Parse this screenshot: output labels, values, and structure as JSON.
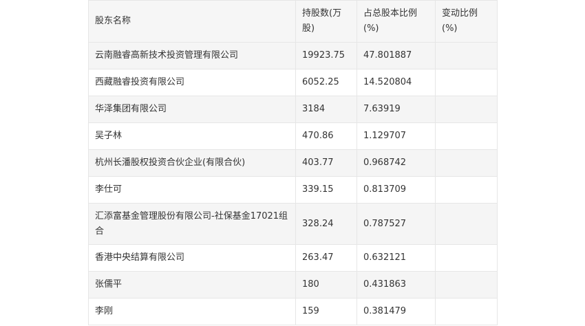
{
  "table": {
    "headers": {
      "name": "股东名称",
      "shares": "持股数(万股)",
      "ratio": "占总股本比例(%)",
      "change": "变动比例(%)"
    },
    "rows": [
      {
        "name": "云南融睿高新技术投资管理有限公司",
        "shares": "19923.75",
        "ratio": "47.801887",
        "change": ""
      },
      {
        "name": "西藏融睿投资有限公司",
        "shares": "6052.25",
        "ratio": "14.520804",
        "change": ""
      },
      {
        "name": "华泽集团有限公司",
        "shares": "3184",
        "ratio": "7.63919",
        "change": ""
      },
      {
        "name": "吴子林",
        "shares": "470.86",
        "ratio": "1.129707",
        "change": ""
      },
      {
        "name": "杭州长潘股权投资合伙企业(有限合伙)",
        "shares": "403.77",
        "ratio": "0.968742",
        "change": ""
      },
      {
        "name": "李仕可",
        "shares": "339.15",
        "ratio": "0.813709",
        "change": ""
      },
      {
        "name": "汇添富基金管理股份有限公司-社保基金17021组合",
        "shares": "328.24",
        "ratio": "0.787527",
        "change": ""
      },
      {
        "name": "香港中央结算有限公司",
        "shares": "263.47",
        "ratio": "0.632121",
        "change": ""
      },
      {
        "name": "张儒平",
        "shares": "180",
        "ratio": "0.431863",
        "change": ""
      },
      {
        "name": "李刚",
        "shares": "159",
        "ratio": "0.381479",
        "change": ""
      }
    ]
  }
}
